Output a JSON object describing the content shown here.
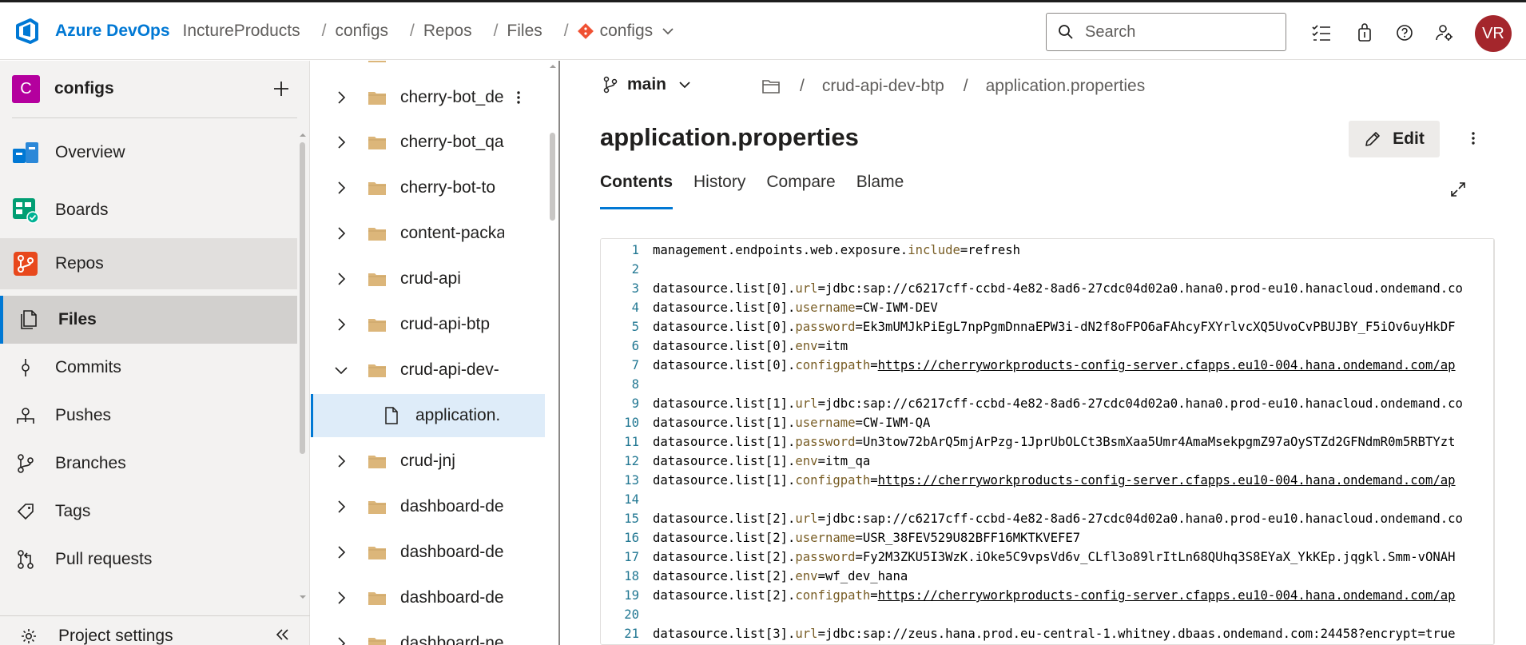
{
  "header": {
    "brand": "Azure DevOps",
    "breadcrumb": [
      "InctureProducts",
      "configs",
      "Repos",
      "Files"
    ],
    "repo_name": "configs",
    "search_placeholder": "Search",
    "avatar_initials": "VR",
    "avatar_color": "#a4262c"
  },
  "sidebar": {
    "project_initial": "C",
    "project_name": "configs",
    "project_color": "#b4009e",
    "items": [
      {
        "label": "Overview",
        "icon": "overview-icon"
      },
      {
        "label": "Boards",
        "icon": "boards-icon"
      },
      {
        "label": "Repos",
        "icon": "repos-icon"
      },
      {
        "label": "Files",
        "icon": "files-icon"
      },
      {
        "label": "Commits",
        "icon": "commits-icon"
      },
      {
        "label": "Pushes",
        "icon": "pushes-icon"
      },
      {
        "label": "Branches",
        "icon": "branches-icon"
      },
      {
        "label": "Tags",
        "icon": "tags-icon"
      },
      {
        "label": "Pull requests",
        "icon": "pull-requests-icon"
      }
    ],
    "settings_label": "Project settings"
  },
  "tree": {
    "items": [
      {
        "name": "cherry-bot_de",
        "type": "folder",
        "expanded": false
      },
      {
        "name": "cherry-bot_qa",
        "type": "folder",
        "expanded": false
      },
      {
        "name": "cherry-bot-to",
        "type": "folder",
        "expanded": false
      },
      {
        "name": "content-packa",
        "type": "folder",
        "expanded": false
      },
      {
        "name": "crud-api",
        "type": "folder",
        "expanded": false
      },
      {
        "name": "crud-api-btp",
        "type": "folder",
        "expanded": false
      },
      {
        "name": "crud-api-dev-",
        "type": "folder",
        "expanded": true
      },
      {
        "name": "application.",
        "type": "file",
        "selected": true
      },
      {
        "name": "crud-jnj",
        "type": "folder",
        "expanded": false
      },
      {
        "name": "dashboard-de",
        "type": "folder",
        "expanded": false
      },
      {
        "name": "dashboard-de",
        "type": "folder",
        "expanded": false
      },
      {
        "name": "dashboard-de",
        "type": "folder",
        "expanded": false
      },
      {
        "name": "dashboard-ne",
        "type": "folder",
        "expanded": false
      }
    ]
  },
  "main": {
    "branch": "main",
    "path": [
      "crud-api-dev-btp",
      "application.properties"
    ],
    "file_title": "application.properties",
    "edit_label": "Edit",
    "tabs": [
      "Contents",
      "History",
      "Compare",
      "Blame"
    ],
    "active_tab": "Contents",
    "code_lines": [
      {
        "n": "1",
        "text": "management.endpoints.web.exposure.include=refresh"
      },
      {
        "n": "2",
        "text": ""
      },
      {
        "n": "3",
        "text": "datasource.list[0].url=jdbc:sap://c6217cff-ccbd-4e82-8ad6-27cdc04d02a0.hana0.prod-eu10.hanacloud.ondemand.co"
      },
      {
        "n": "4",
        "text": "datasource.list[0].username=CW-IWM-DEV"
      },
      {
        "n": "5",
        "text": "datasource.list[0].password=Ek3mUMJkPiEgL7npPgmDnnaEPW3i-dN2f8oFPO6aFAhcyFXYrlvcXQ5UvoCvPBUJBY_F5iOv6uyHkDF"
      },
      {
        "n": "6",
        "text": "datasource.list[0].env=itm"
      },
      {
        "n": "7",
        "text": "datasource.list[0].configpath=https://cherryworkproducts-config-server.cfapps.eu10-004.hana.ondemand.com/ap"
      },
      {
        "n": "8",
        "text": ""
      },
      {
        "n": "9",
        "text": "datasource.list[1].url=jdbc:sap://c6217cff-ccbd-4e82-8ad6-27cdc04d02a0.hana0.prod-eu10.hanacloud.ondemand.co"
      },
      {
        "n": "10",
        "text": "datasource.list[1].username=CW-IWM-QA"
      },
      {
        "n": "11",
        "text": "datasource.list[1].password=Un3tow72bArQ5mjArPzg-1JprUbOLCt3BsmXaa5Umr4AmaMsekpgmZ97aOySTZd2GFNdmR0m5RBTYzt"
      },
      {
        "n": "12",
        "text": "datasource.list[1].env=itm_qa"
      },
      {
        "n": "13",
        "text": "datasource.list[1].configpath=https://cherryworkproducts-config-server.cfapps.eu10-004.hana.ondemand.com/ap"
      },
      {
        "n": "14",
        "text": ""
      },
      {
        "n": "15",
        "text": "datasource.list[2].url=jdbc:sap://c6217cff-ccbd-4e82-8ad6-27cdc04d02a0.hana0.prod-eu10.hanacloud.ondemand.co"
      },
      {
        "n": "16",
        "text": "datasource.list[2].username=USR_38FEV529U82BFF16MKTKVEFE7"
      },
      {
        "n": "17",
        "text": "datasource.list[2].password=Fy2M3ZKU5I3WzK.iOke5C9vpsVd6v_CLfl3o89lrItLn68QUhq3S8EYaX_YkKEp.jqgkl.Smm-vONAH"
      },
      {
        "n": "18",
        "text": "datasource.list[2].env=wf_dev_hana"
      },
      {
        "n": "19",
        "text": "datasource.list[2].configpath=https://cherryworkproducts-config-server.cfapps.eu10-004.hana.ondemand.com/ap"
      },
      {
        "n": "20",
        "text": ""
      },
      {
        "n": "21",
        "text": "datasource.list[3].url=jdbc:sap://zeus.hana.prod.eu-central-1.whitney.dbaas.ondemand.com:24458?encrypt=true"
      }
    ]
  }
}
